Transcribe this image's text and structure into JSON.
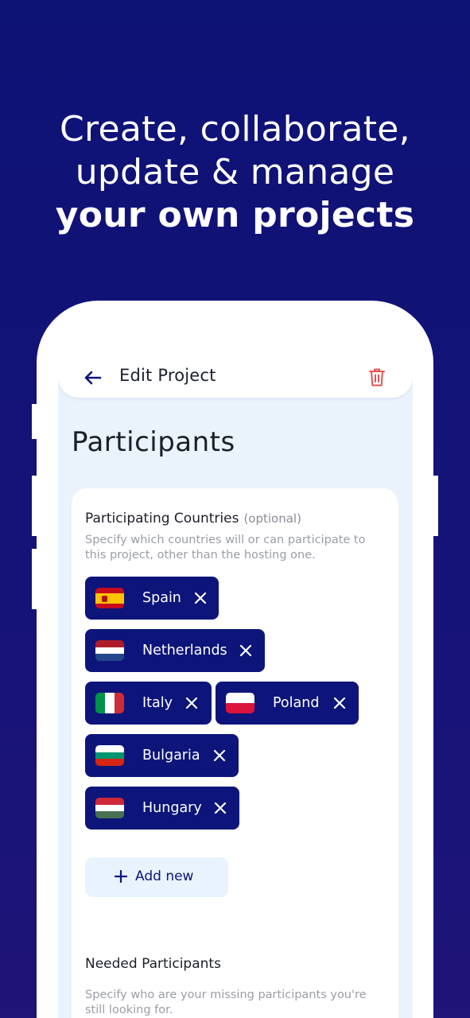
{
  "colors": {
    "background": "#0d1275",
    "chip": "#0d157a",
    "danger": "#e25555",
    "screen": "#eaf3fc"
  },
  "headline": {
    "line1": "Create, collaborate,",
    "line2": "update & manage",
    "line3": "your own projects"
  },
  "appbar": {
    "title": "Edit Project",
    "back_icon": "arrow-left-icon",
    "delete_icon": "trash-icon"
  },
  "section": {
    "title": "Participants"
  },
  "participating_countries": {
    "label": "Participating Countries",
    "optional": "(optional)",
    "description": "Specify which countries will or can participate to this project, other than the hosting one.",
    "countries": [
      {
        "name": "Spain",
        "flag": "spain-flag-icon"
      },
      {
        "name": "Netherlands",
        "flag": "netherlands-flag-icon"
      },
      {
        "name": "Italy",
        "flag": "italy-flag-icon"
      },
      {
        "name": "Poland",
        "flag": "poland-flag-icon"
      },
      {
        "name": "Bulgaria",
        "flag": "bulgaria-flag-icon"
      },
      {
        "name": "Hungary",
        "flag": "hungary-flag-icon"
      }
    ],
    "add_label": "Add new"
  },
  "needed_participants": {
    "label": "Needed Participants",
    "description": "Specify who are your missing participants you're still looking for."
  }
}
